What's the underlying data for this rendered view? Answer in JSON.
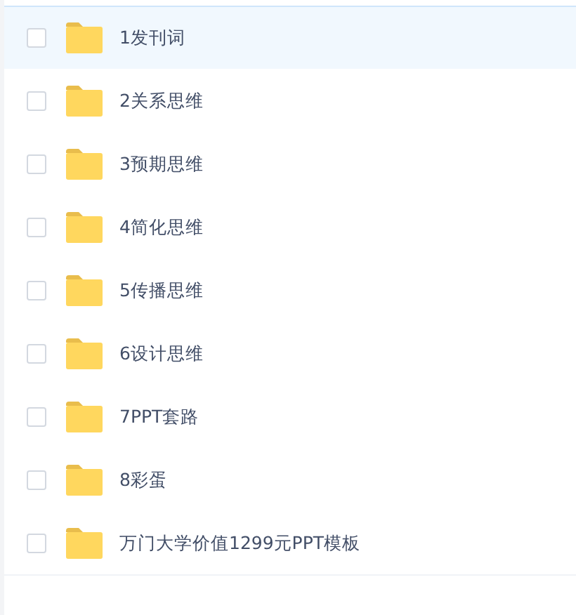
{
  "files": [
    {
      "name": "1发刊词",
      "highlighted": true,
      "checked": false
    },
    {
      "name": "2关系思维",
      "highlighted": false,
      "checked": false
    },
    {
      "name": "3预期思维",
      "highlighted": false,
      "checked": false
    },
    {
      "name": "4简化思维",
      "highlighted": false,
      "checked": false
    },
    {
      "name": "5传播思维",
      "highlighted": false,
      "checked": false
    },
    {
      "name": "6设计思维",
      "highlighted": false,
      "checked": false
    },
    {
      "name": "7PPT套路",
      "highlighted": false,
      "checked": false
    },
    {
      "name": "8彩蛋",
      "highlighted": false,
      "checked": false
    },
    {
      "name": "万门大学价值1299元PPT模板",
      "highlighted": false,
      "checked": false
    }
  ]
}
